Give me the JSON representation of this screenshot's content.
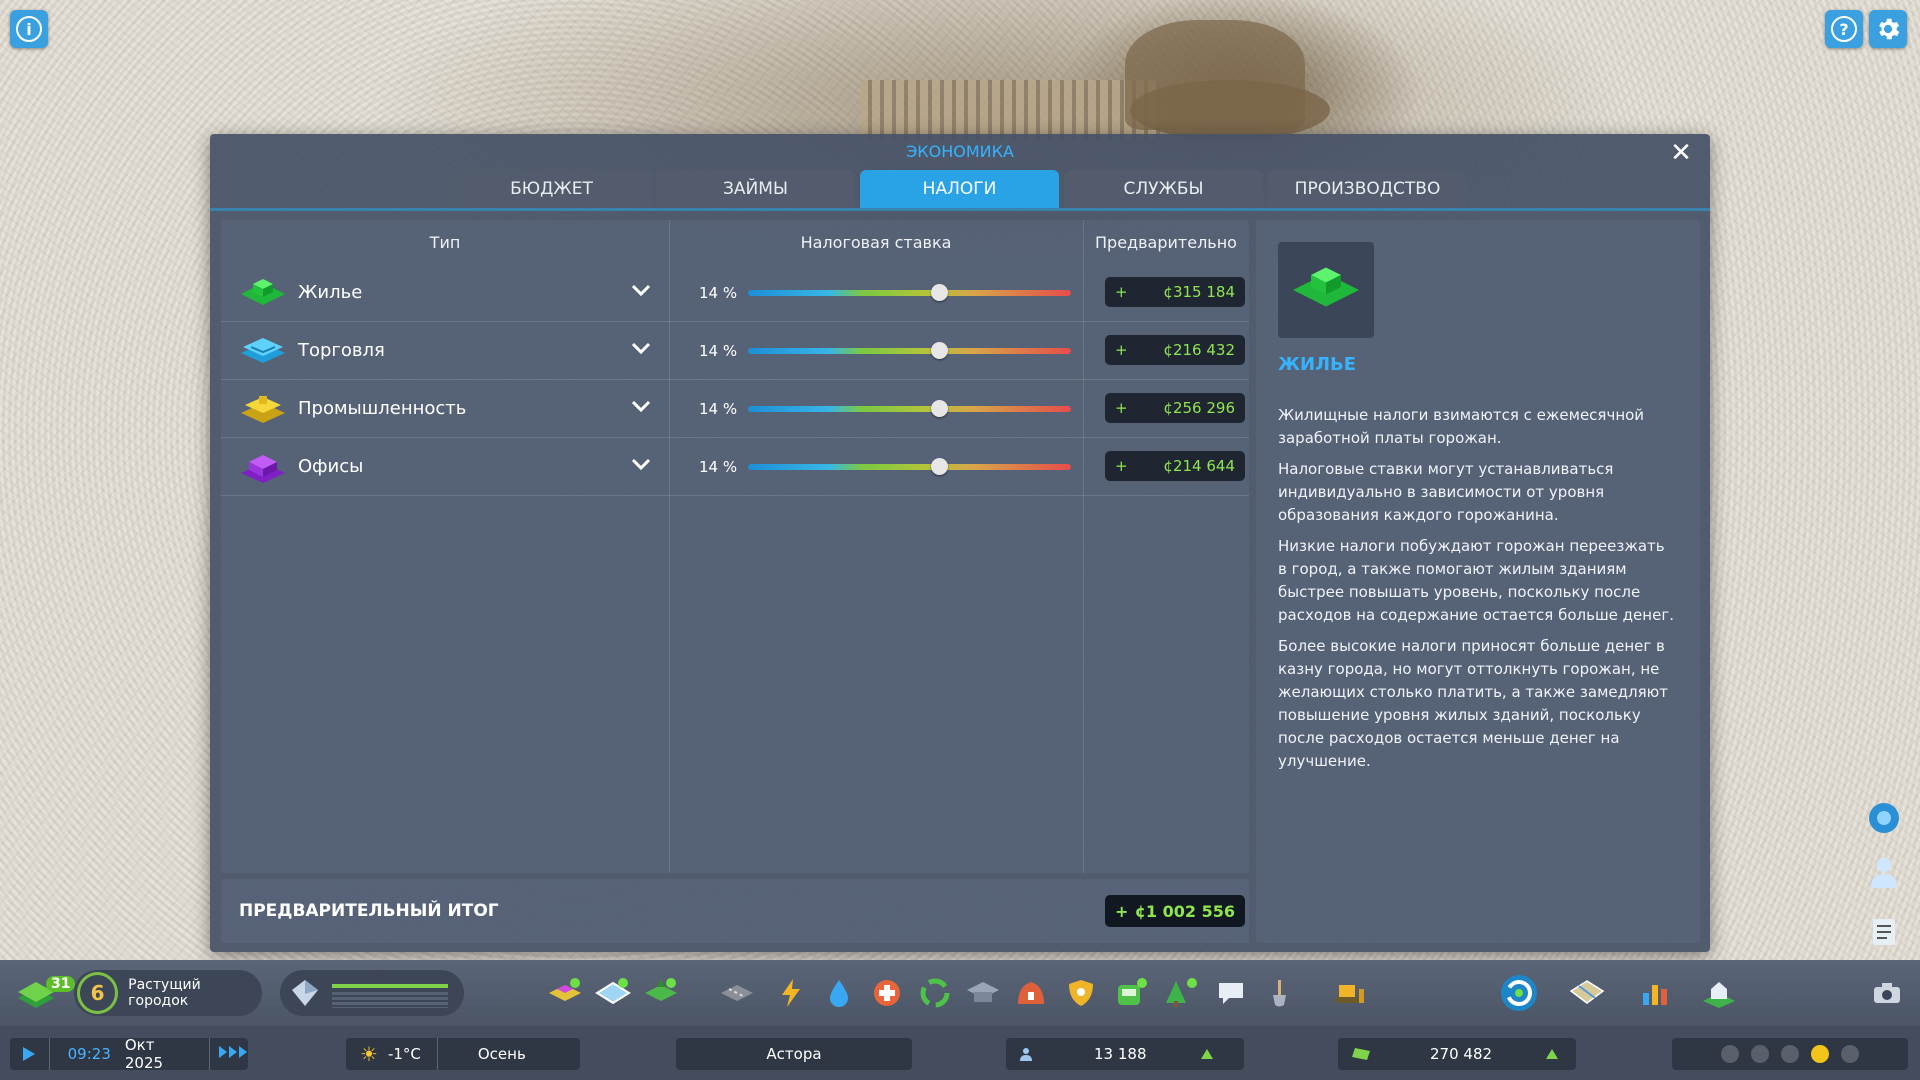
{
  "top_buttons": {
    "info": "i",
    "help": "?",
    "settings": "⚙"
  },
  "panel": {
    "title": "ЭКОНОМИКА",
    "close": "✕",
    "tabs": [
      {
        "label": "БЮДЖЕТ",
        "active": false
      },
      {
        "label": "ЗАЙМЫ",
        "active": false
      },
      {
        "label": "НАЛОГИ",
        "active": true
      },
      {
        "label": "СЛУЖБЫ",
        "active": false
      },
      {
        "label": "ПРОИЗВОДСТВО",
        "active": false
      }
    ]
  },
  "tax_table": {
    "headers": {
      "type": "Тип",
      "rate": "Налоговая ставка",
      "preview": "Предварительно"
    },
    "rows": [
      {
        "label": "Жилье",
        "icon": "residential-icon",
        "color": "#2fe64a",
        "rate_text": "14 %",
        "rate": 14,
        "slider_fraction": 0.59,
        "sign": "+",
        "amount": "¢315 184"
      },
      {
        "label": "Торговля",
        "icon": "commercial-icon",
        "color": "#35b8f0",
        "rate_text": "14 %",
        "rate": 14,
        "slider_fraction": 0.59,
        "sign": "+",
        "amount": "¢216 432"
      },
      {
        "label": "Промышленность",
        "icon": "industrial-icon",
        "color": "#f2cd22",
        "rate_text": "14 %",
        "rate": 14,
        "slider_fraction": 0.59,
        "sign": "+",
        "amount": "¢256 296"
      },
      {
        "label": "Офисы",
        "icon": "office-icon",
        "color": "#a23ce6",
        "rate_text": "14 %",
        "rate": 14,
        "slider_fraction": 0.59,
        "sign": "+",
        "amount": "¢214 644"
      }
    ],
    "total_label": "ПРЕДВАРИТЕЛЬНЫЙ ИТОГ",
    "total_sign": "+",
    "total_amount": "¢1 002 556"
  },
  "info": {
    "icon": "residential-icon",
    "title": "ЖИЛЬЕ",
    "paragraphs": [
      "Жилищные налоги взимаются с ежемесячной заработной платы горожан.",
      "Налоговые ставки могут устанавливаться индивидуально в зависимости от уровня образования каждого горожанина.",
      "Низкие налоги побуждают горожан переезжать в город, а также помогают жилым зданиям быстрее повышать уровень, поскольку после расходов на содержание остается больше денег.",
      "Более высокие налоги приносят больше денег в казну города, но могут оттолкнуть горожан, не желающих столько платить, а также замедляют повышение уровня жилых зданий, поскольку после расходов остается меньше денег на улучшение."
    ]
  },
  "toolbar": {
    "level": "31",
    "milestone_number": "6",
    "milestone_name": "Растущий городок",
    "milestone_progress": 1.0,
    "icons": [
      "zoning-icon",
      "area-icon",
      "landscaping-icon",
      "roads-icon",
      "electricity-icon",
      "water-icon",
      "health-icon",
      "garbage-icon",
      "education-icon",
      "fire-icon",
      "police-icon",
      "transport-icon",
      "parks-icon",
      "communications-icon",
      "landscape-tool-icon",
      "bulldozer-icon",
      "progression-icon",
      "map-tiles-icon",
      "statistics-icon",
      "city-services-icon",
      "photo-mode-icon"
    ]
  },
  "statusbar": {
    "time": "09:23",
    "date": "Окт 2025",
    "temperature": "-1°C",
    "season": "Осень",
    "city_name": "Астора",
    "population": "13 188",
    "money": "270 482",
    "happiness_level": 4
  }
}
